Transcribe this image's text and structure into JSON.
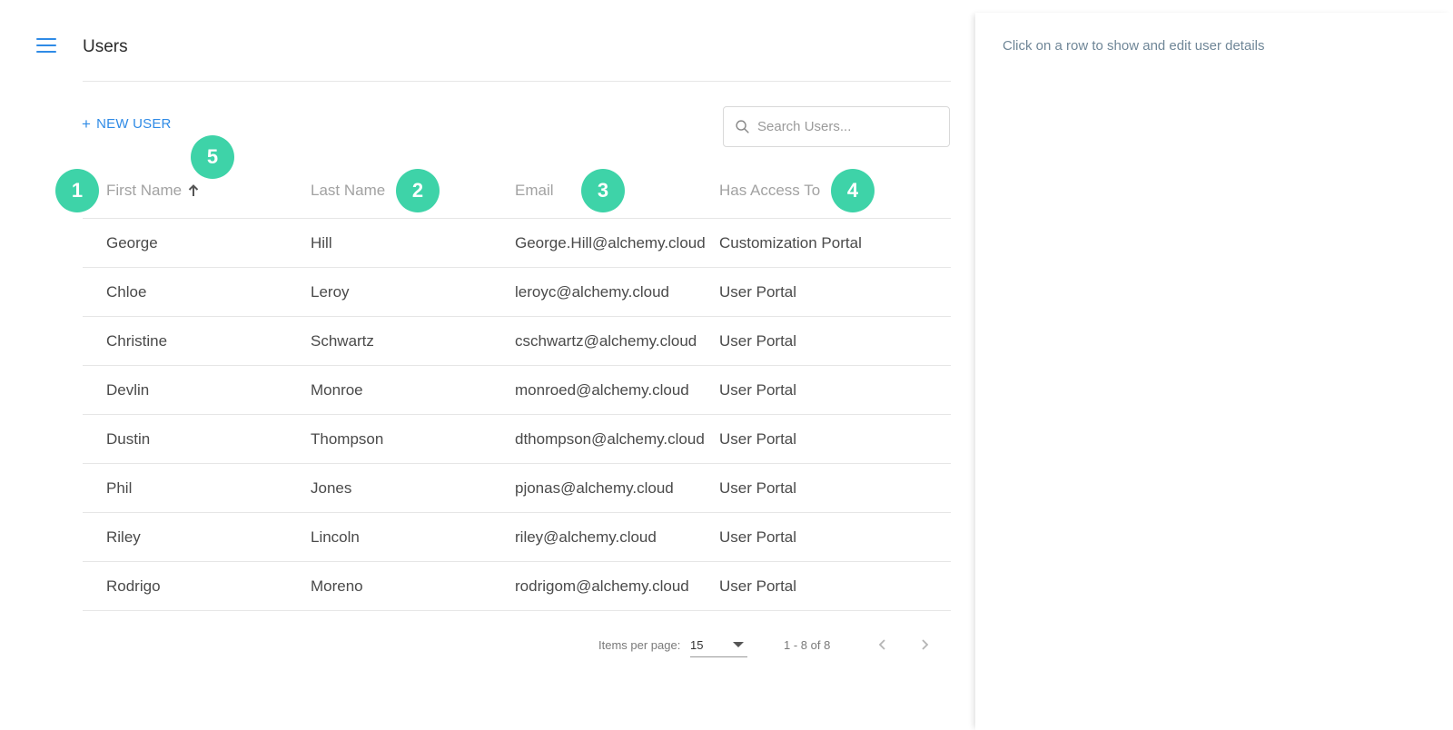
{
  "header": {
    "title": "Users",
    "menu_icon": "hamburger-menu-icon"
  },
  "toolbar": {
    "new_user_label": "NEW USER",
    "plus_glyph": "+"
  },
  "search": {
    "placeholder": "Search Users...",
    "value": ""
  },
  "table": {
    "columns": [
      "First Name",
      "Last Name",
      "Email",
      "Has Access To"
    ],
    "sort": {
      "column": "First Name",
      "direction": "ascending"
    },
    "rows": [
      [
        "George",
        "Hill",
        "George.Hill@alchemy.cloud",
        "Customization Portal"
      ],
      [
        "Chloe",
        "Leroy",
        "leroyc@alchemy.cloud",
        "User Portal"
      ],
      [
        "Christine",
        "Schwartz",
        "cschwartz@alchemy.cloud",
        "User Portal"
      ],
      [
        "Devlin",
        "Monroe",
        "monroed@alchemy.cloud",
        "User Portal"
      ],
      [
        "Dustin",
        "Thompson",
        "dthompson@alchemy.cloud",
        "User Portal"
      ],
      [
        "Phil",
        "Jones",
        "pjonas@alchemy.cloud",
        "User Portal"
      ],
      [
        "Riley",
        "Lincoln",
        "riley@alchemy.cloud",
        "User Portal"
      ],
      [
        "Rodrigo",
        "Moreno",
        "rodrigom@alchemy.cloud",
        "User Portal"
      ]
    ]
  },
  "markers": [
    "1",
    "2",
    "3",
    "4",
    "5"
  ],
  "paginator": {
    "items_per_page_label": "Items per page:",
    "items_per_page": "15",
    "range_label": "1 - 8 of 8"
  },
  "detail": {
    "hint": "Click on a row to show and edit user details"
  },
  "colors": {
    "accent": "#2f8be6",
    "marker": "#3ed3a8",
    "hint_text": "#6f8697"
  }
}
